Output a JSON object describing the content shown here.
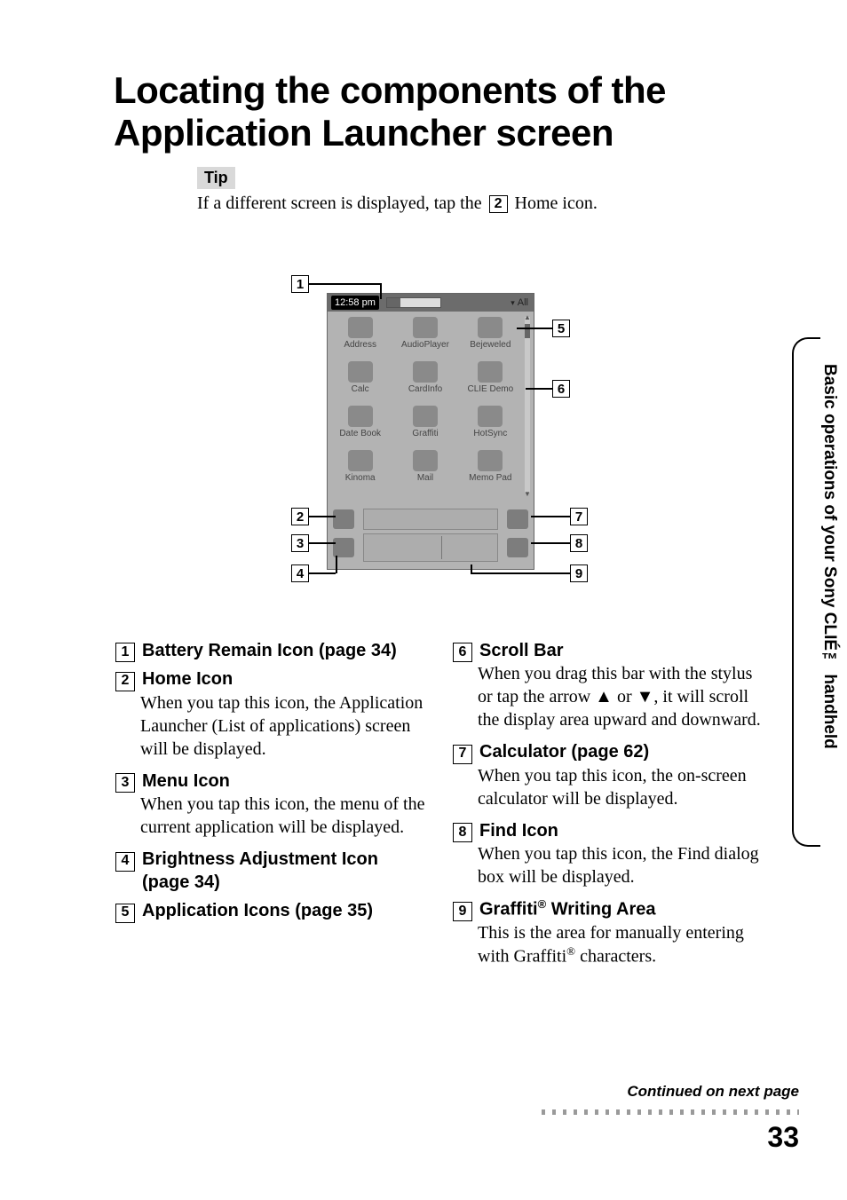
{
  "title": "Locating the components of the Application Launcher screen",
  "tip_label": "Tip",
  "tip_before": "If a different screen is displayed, tap the ",
  "tip_num": "2",
  "tip_after": " Home icon.",
  "screenshot": {
    "clock": "12:58 pm",
    "category": "All",
    "apps": [
      "Address",
      "AudioPlayer",
      "Bejeweled",
      "Calc",
      "CardInfo",
      "CLIE Demo",
      "Date Book",
      "Graffiti",
      "HotSync",
      "Kinoma",
      "Mail",
      "Memo Pad"
    ]
  },
  "callouts": [
    "1",
    "2",
    "3",
    "4",
    "5",
    "6",
    "7",
    "8",
    "9"
  ],
  "left": [
    {
      "n": "1",
      "head": "Battery Remain Icon (page 34)",
      "body": ""
    },
    {
      "n": "2",
      "head": "Home Icon",
      "body": "When you tap this icon, the Application Launcher (List of applications) screen will be displayed."
    },
    {
      "n": "3",
      "head": "Menu Icon",
      "body": "When you tap this icon, the menu of the current application will be displayed."
    },
    {
      "n": "4",
      "head": "Brightness Adjustment Icon (page 34)",
      "body": ""
    },
    {
      "n": "5",
      "head": "Application Icons (page 35)",
      "body": ""
    }
  ],
  "right": [
    {
      "n": "6",
      "head": "Scroll Bar",
      "body": "When you drag this bar with the stylus or tap the arrow ▲ or ▼, it will scroll the display area upward and downward."
    },
    {
      "n": "7",
      "head": "Calculator (page 62)",
      "body": "When you tap this icon, the on-screen calculator will be displayed."
    },
    {
      "n": "8",
      "head": "Find Icon",
      "body": "When you tap this icon, the Find dialog box will be displayed."
    },
    {
      "n": "9",
      "head": "Graffiti® Writing Area",
      "body": "This is the area for manually entering with Graffiti® characters."
    }
  ],
  "side_tab": "Basic operations of your Sony CLIÉ™ handheld",
  "continued": "Continued on next page",
  "page_number": "33"
}
